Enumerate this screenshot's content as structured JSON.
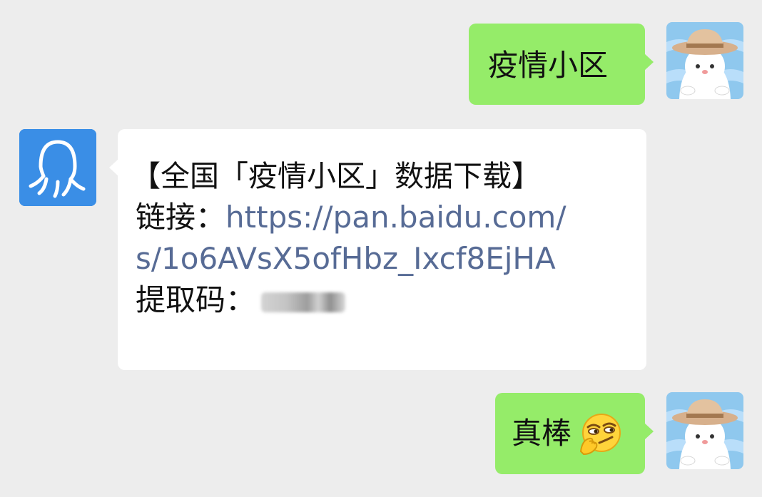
{
  "messages": [
    {
      "side": "sent",
      "text": "疫情小区"
    },
    {
      "side": "received",
      "title": "【全国「疫情小区」数据下载】",
      "link_label": "链接：",
      "link_part1": "https://pan.baidu.com/",
      "link_part2": "s/1o6AVsX5ofHbz_Ixcf8EjHA",
      "code_label": "提取码："
    },
    {
      "side": "sent",
      "text": "真棒"
    }
  ],
  "colors": {
    "background": "#ededed",
    "sent_bubble": "#95ec69",
    "received_bubble": "#ffffff",
    "link": "#576b95",
    "avatar_bot": "#3a8ee6"
  },
  "icons": {
    "user_avatar": "hat-character-icon",
    "bot_avatar": "octopus-icon",
    "emoji": "smirk-face-icon"
  }
}
